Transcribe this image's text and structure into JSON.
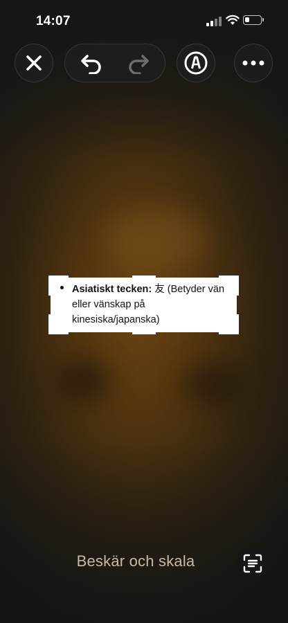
{
  "status_bar": {
    "time": "14:07",
    "signal_icon": "cellular-signal-icon",
    "wifi_icon": "wifi-icon",
    "battery_icon": "battery-icon",
    "battery_level": 0.3
  },
  "toolbar": {
    "close_icon": "close-icon",
    "undo_icon": "undo-icon",
    "redo_icon": "redo-icon",
    "markup_icon": "markup-pen-icon",
    "more_icon": "more-icon"
  },
  "crop_content": {
    "bullet_bold": "Asiatiskt tecken:",
    "bullet_text": " 友 (Betyder vän eller vänskap på kinesiska/japanska)"
  },
  "footer": {
    "label": "Beskär och skala",
    "scan_icon": "live-text-scan-icon"
  },
  "colors": {
    "background_center": "#6a4410",
    "background_edge": "#171616",
    "footer_text": "#c9b9a4"
  }
}
